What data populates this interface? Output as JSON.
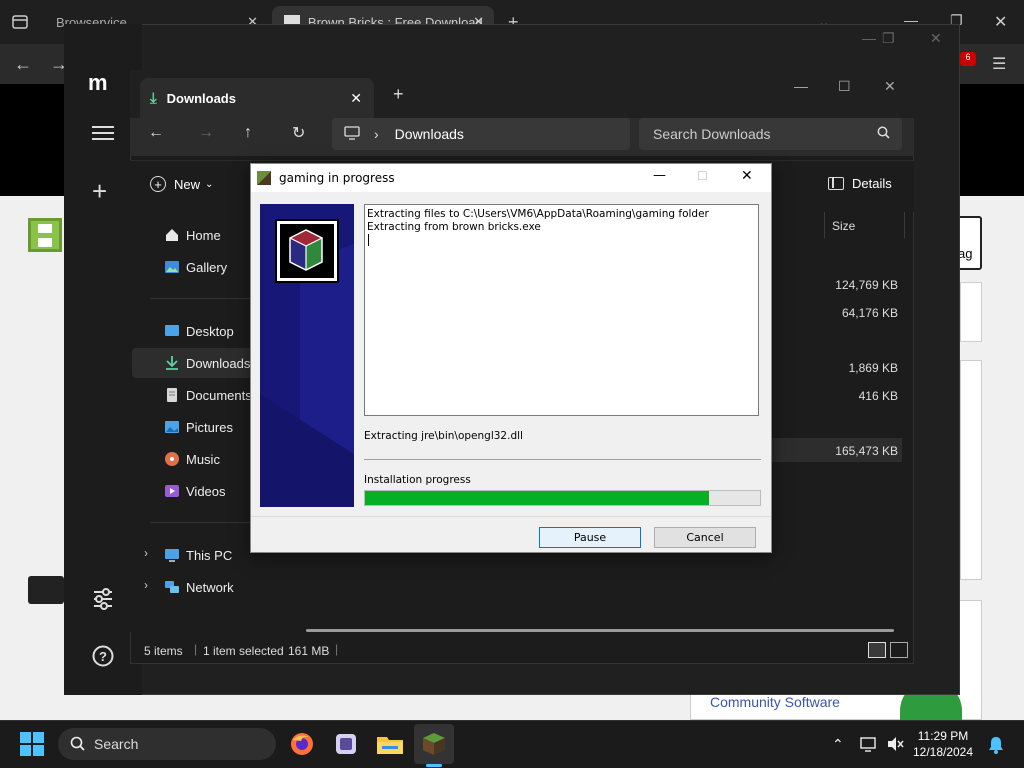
{
  "browser": {
    "tab1": "Browservice",
    "tab2": "Brown Bricks : Free Download",
    "badge": "6",
    "page_link": "Community Software",
    "page_tag": "ag"
  },
  "explorer": {
    "tab_title": "Downloads",
    "address": "Downloads",
    "search_placeholder": "Search Downloads",
    "new_label": "New",
    "details_label": "Details",
    "size_header": "Size",
    "sidebar": [
      {
        "label": "Home"
      },
      {
        "label": "Gallery"
      },
      {
        "label": "Desktop"
      },
      {
        "label": "Downloads"
      },
      {
        "label": "Documents"
      },
      {
        "label": "Pictures"
      },
      {
        "label": "Music"
      },
      {
        "label": "Videos"
      },
      {
        "label": "This PC"
      },
      {
        "label": "Network"
      }
    ],
    "sizes": [
      "124,769 KB",
      "64,176 KB",
      "1,869 KB",
      "416 KB",
      "165,473 KB"
    ],
    "status": {
      "items": "5 items",
      "selected": "1 item selected",
      "size": "161 MB"
    }
  },
  "installer": {
    "title": "gaming in progress",
    "log_line1": "Extracting files to C:\\Users\\VM6\\AppData\\Roaming\\gaming folder",
    "log_line2": "Extracting from brown bricks.exe",
    "current_file": "Extracting jre\\bin\\opengl32.dll",
    "progress_label": "Installation progress",
    "progress_fraction": 0.87,
    "pause_label": "Pause",
    "cancel_label": "Cancel"
  },
  "taskbar": {
    "search_label": "Search",
    "time": "11:29 PM",
    "date": "12/18/2024"
  },
  "colors": {
    "progress_fill": "#06b025",
    "installer_sidebar": "#171777",
    "accent": "#0078d7"
  }
}
